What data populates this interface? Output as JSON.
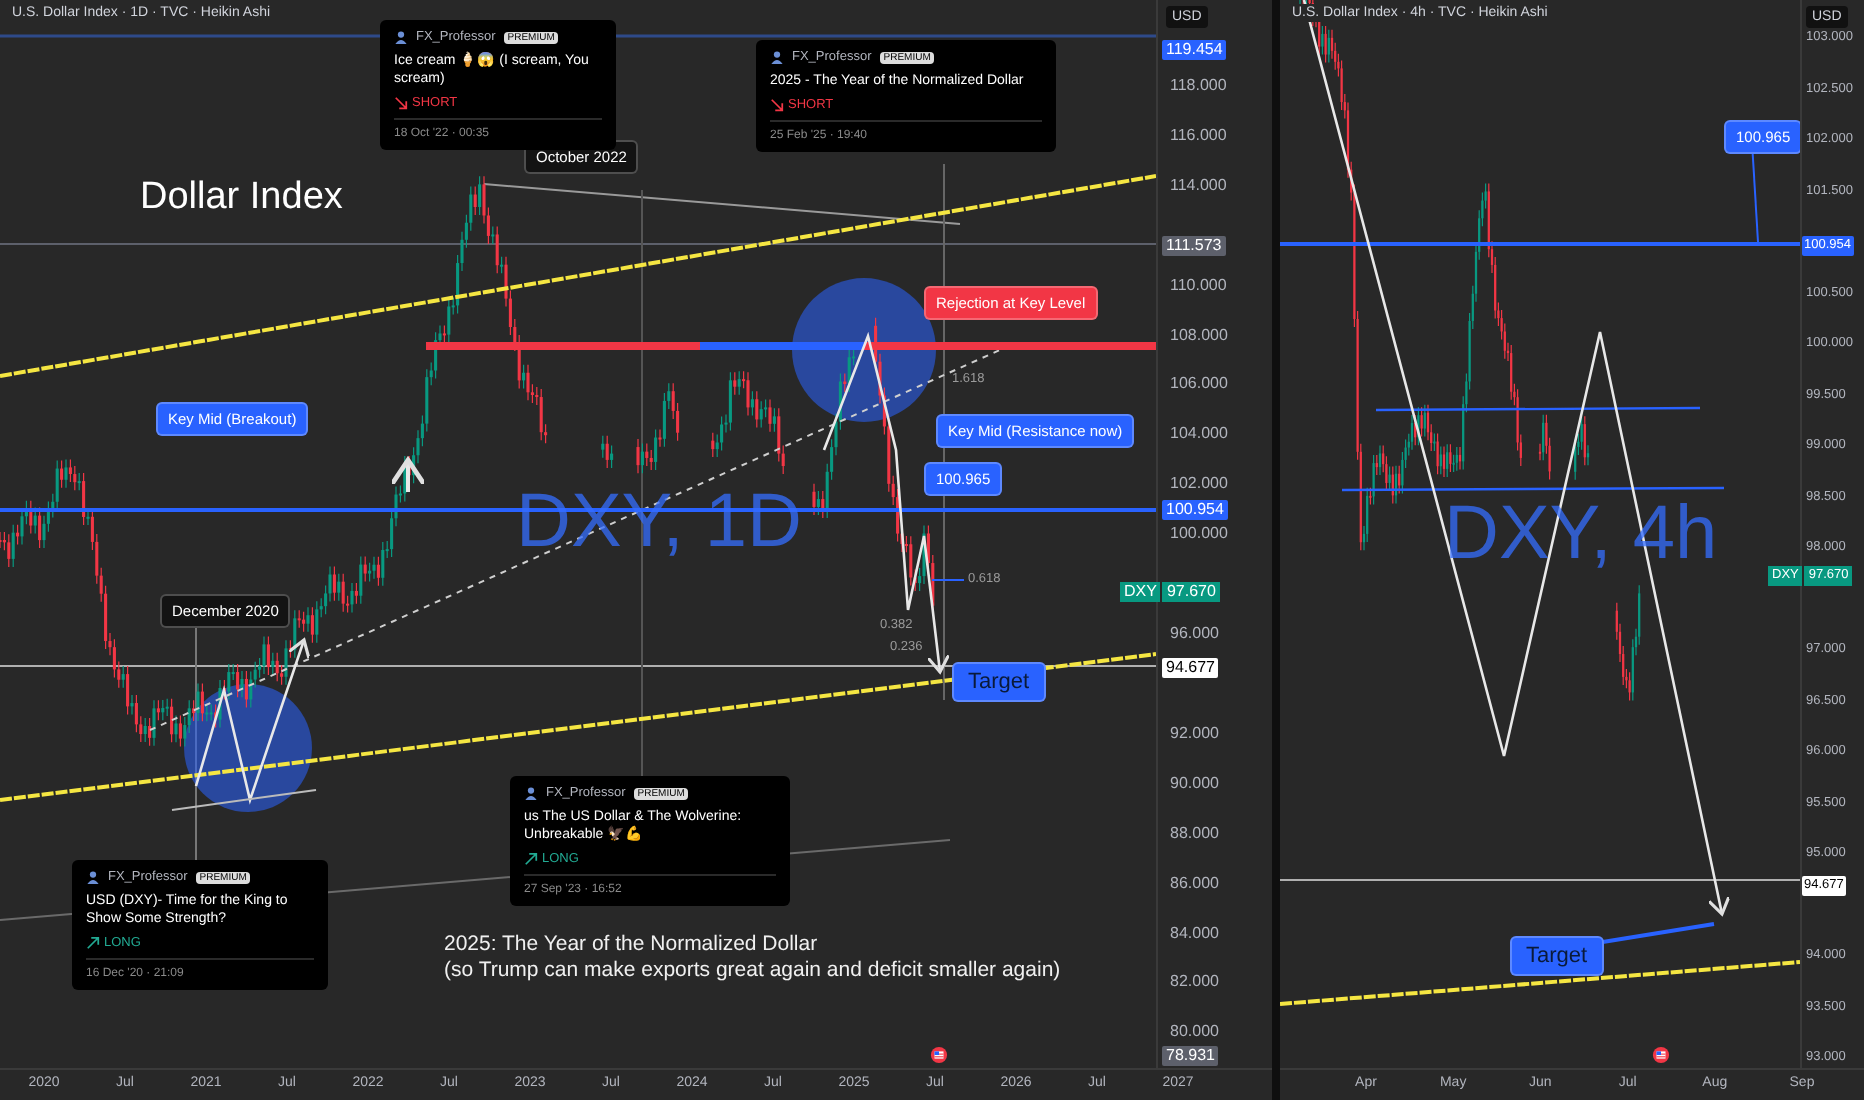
{
  "charts": [
    {
      "title": "U.S. Dollar Index · 1D · TVC · Heikin Ashi",
      "currency": "USD",
      "heading": "Dollar Index",
      "symbol_watermark": "DXY, 1D",
      "price_ticks": [
        "118.000",
        "116.000",
        "114.000",
        "110.000",
        "108.000",
        "106.000",
        "104.000",
        "102.000",
        "100.000",
        "96.000",
        "92.000",
        "90.000",
        "88.000",
        "86.000",
        "84.000",
        "82.000",
        "80.000"
      ],
      "price_tags": [
        {
          "text": "119.454",
          "color": "#2962ff"
        },
        {
          "text": "111.573",
          "color": "#5d606b"
        },
        {
          "text": "100.954",
          "color": "#2962ff"
        },
        {
          "text": "94.677",
          "color": "#ffffff"
        },
        {
          "text": "78.931",
          "color": "#5d606b"
        }
      ],
      "symbol_tag": {
        "symbol": "DXY",
        "price": "97.670"
      },
      "time_ticks": [
        "2020",
        "Jul",
        "2021",
        "Jul",
        "2022",
        "Jul",
        "2023",
        "Jul",
        "2024",
        "Jul",
        "2025",
        "Jul",
        "2026",
        "Jul",
        "2027"
      ],
      "callouts": [
        {
          "text": "October 2022",
          "color": "#131313"
        },
        {
          "text": "December 2020",
          "color": "#131313"
        },
        {
          "text": "Rejection at Key Level",
          "color": "#f23645"
        },
        {
          "text": "Key Mid (Breakout)",
          "color": "#2962ff"
        },
        {
          "text": "Key Mid (Resistance now)",
          "color": "#2962ff"
        },
        {
          "text": "100.965",
          "color": "#2962ff"
        },
        {
          "text": "Target",
          "color": "#2962ff"
        }
      ],
      "idea_cards": [
        {
          "author": "FX_Professor",
          "badge": "PREMIUM",
          "title": "Ice cream 🍦😱 (I scream, You scream)",
          "direction": "SHORT",
          "kind": "short",
          "date": "18 Oct '22 · 00:35"
        },
        {
          "author": "FX_Professor",
          "badge": "PREMIUM",
          "title": "2025 - The Year of the Normalized Dollar",
          "direction": "SHORT",
          "kind": "short",
          "date": "25 Feb '25 · 19:40"
        },
        {
          "author": "FX_Professor",
          "badge": "PREMIUM",
          "title": "us The US Dollar & The Wolverine: Unbreakable 🦅💪",
          "direction": "LONG",
          "kind": "long",
          "date": "27 Sep '23 · 16:52"
        },
        {
          "author": "FX_Professor",
          "badge": "PREMIUM",
          "title": "USD (DXY)- Time for the King to Show Some Strength?",
          "direction": "LONG",
          "kind": "long",
          "date": "16 Dec '20 · 21:09"
        }
      ],
      "fib_levels": [
        "1.618",
        "0.618",
        "0.382",
        "0.236"
      ],
      "annotation": [
        "2025: The Year of the Normalized Dollar",
        "(so Trump can make exports great again and deficit smaller again)"
      ]
    },
    {
      "title": "U.S. Dollar Index · 4h · TVC · Heikin Ashi",
      "currency": "USD",
      "symbol_watermark": "DXY, 4h",
      "price_ticks": [
        "103.000",
        "102.500",
        "102.000",
        "101.500",
        "100.500",
        "100.000",
        "99.500",
        "99.000",
        "98.500",
        "98.000",
        "97.000",
        "96.500",
        "96.000",
        "95.500",
        "95.000",
        "94.000",
        "93.500",
        "93.000"
      ],
      "price_tags": [
        {
          "text": "100.954",
          "color": "#2962ff"
        },
        {
          "text": "94.677",
          "color": "#ffffff"
        }
      ],
      "symbol_tag": {
        "symbol": "DXY",
        "price": "97.670"
      },
      "time_ticks": [
        "Apr",
        "May",
        "Jun",
        "Jul",
        "Aug",
        "Sep"
      ],
      "callouts": [
        {
          "text": "100.965",
          "color": "#2962ff"
        },
        {
          "text": "Target",
          "color": "#2962ff"
        }
      ]
    }
  ]
}
